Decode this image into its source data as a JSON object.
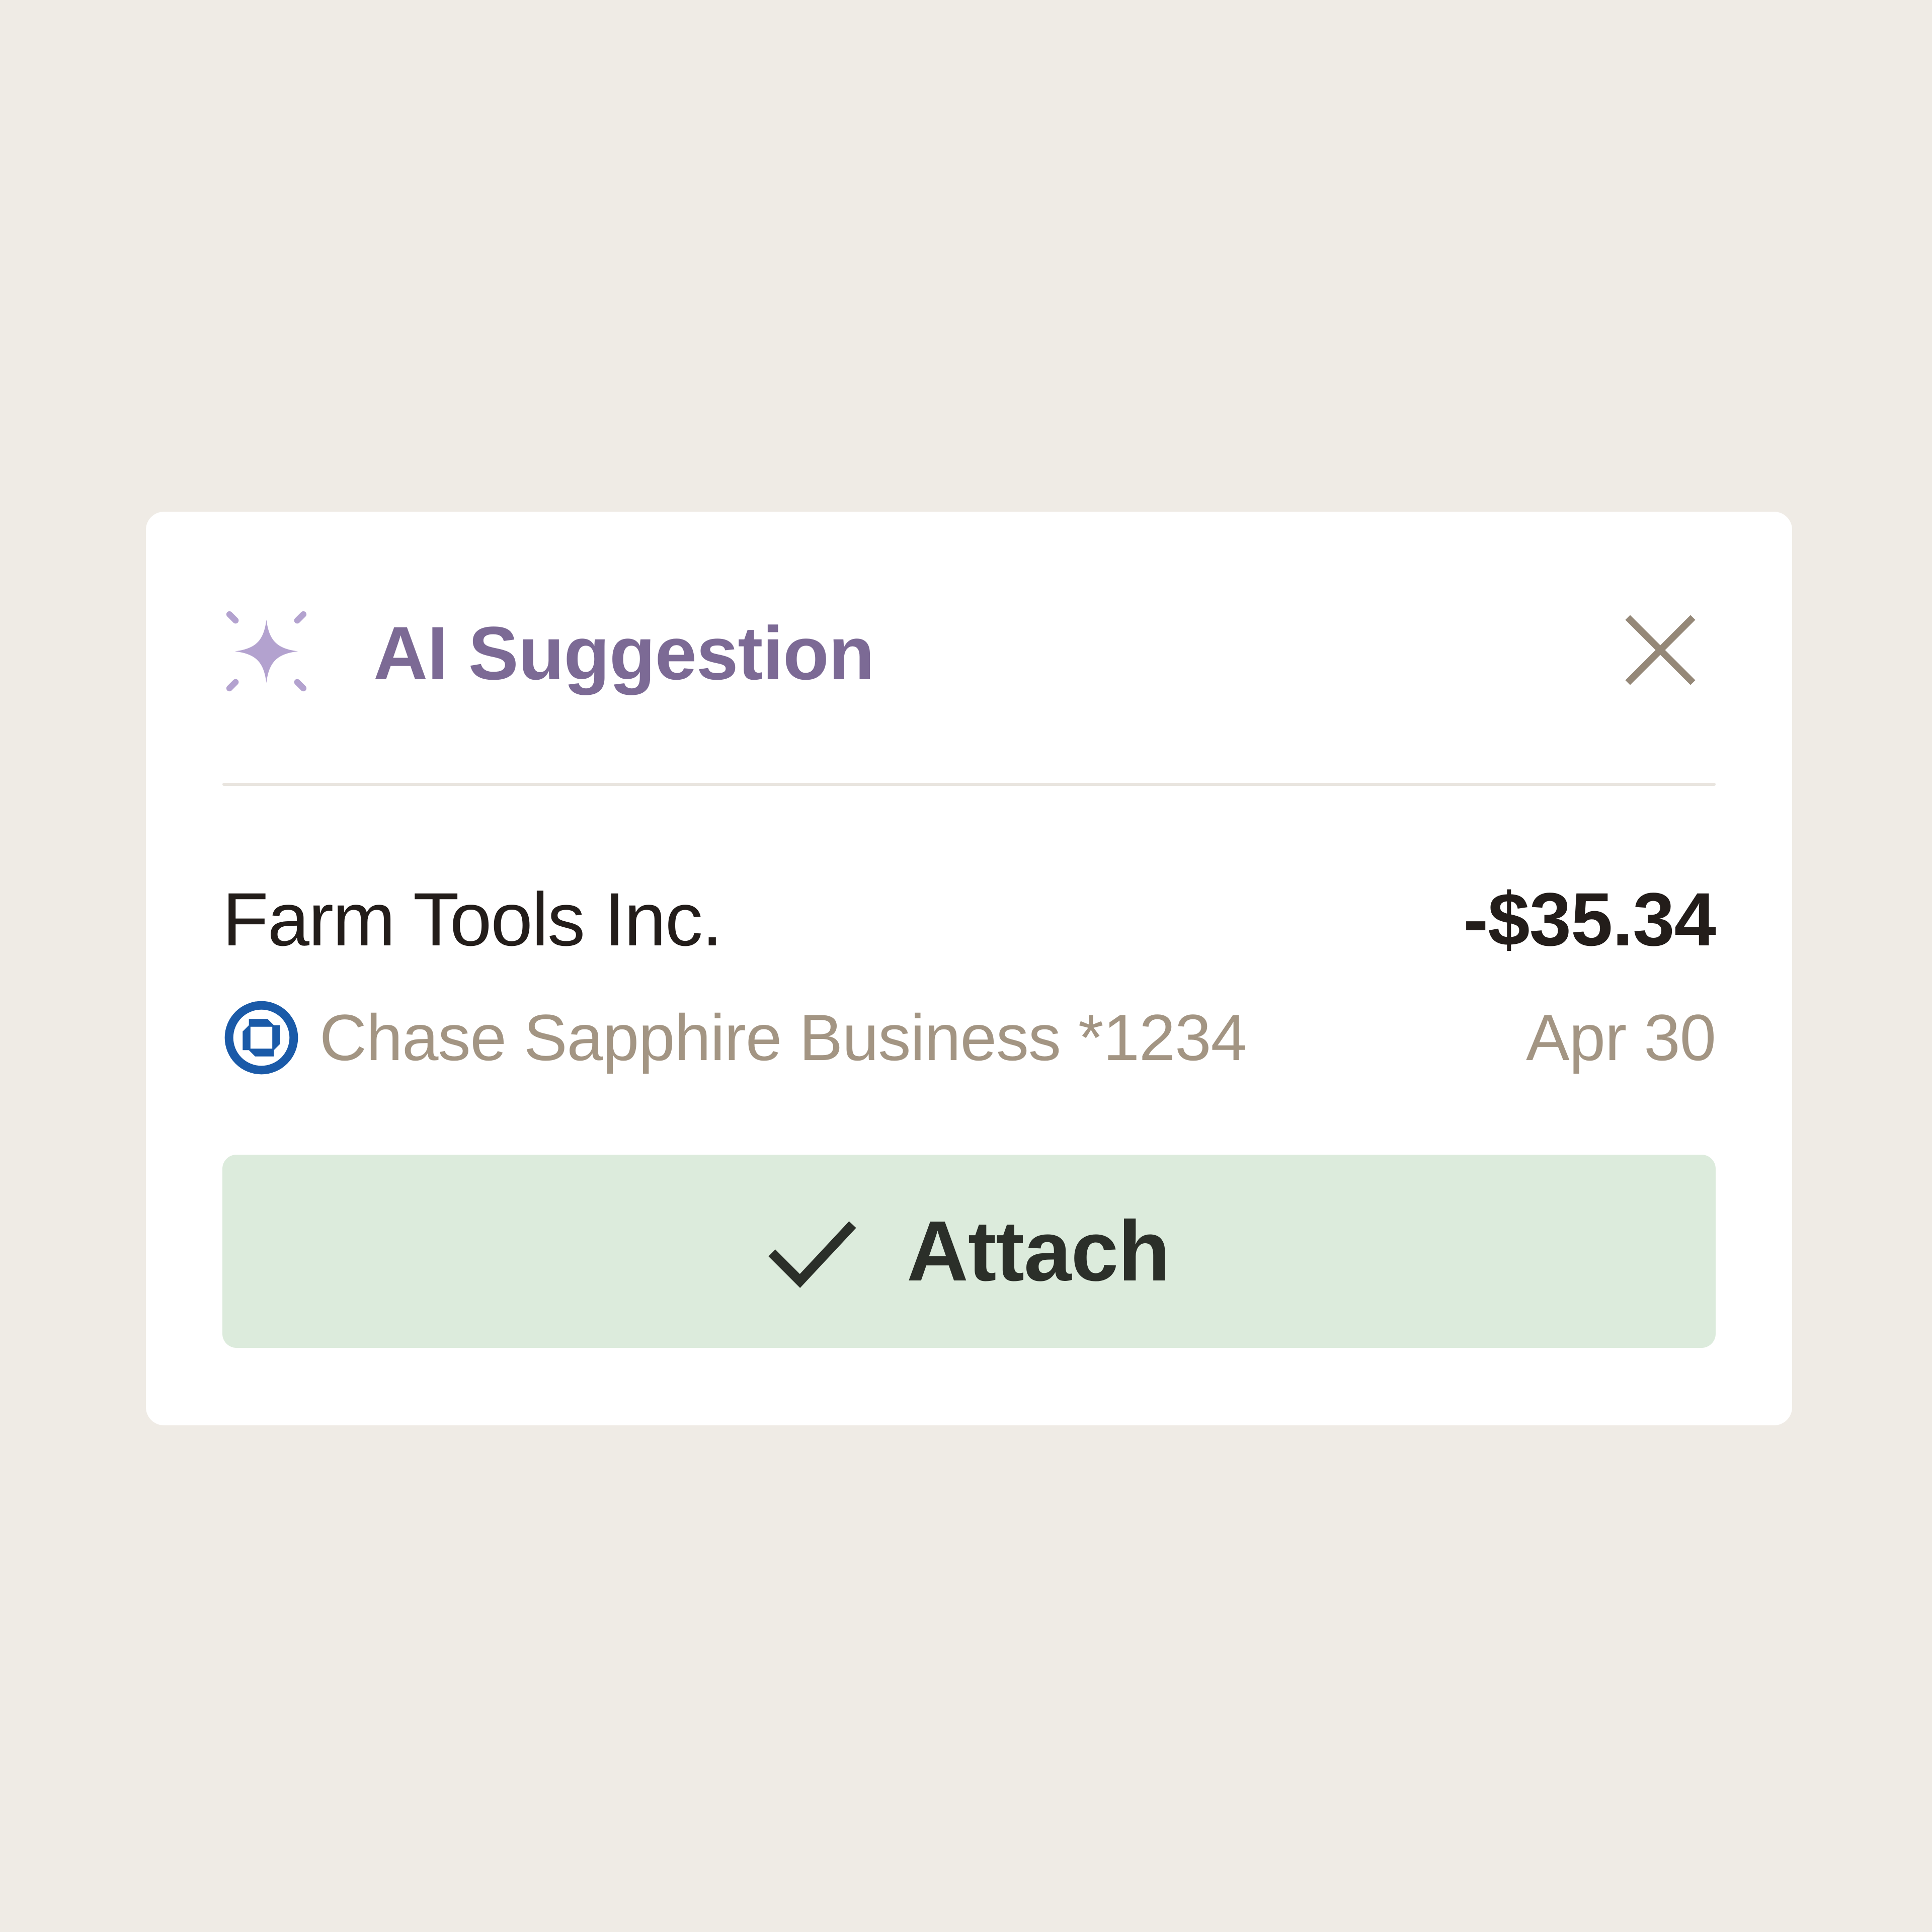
{
  "card": {
    "title": "AI Suggestion",
    "close_label": "Close",
    "transaction": {
      "merchant": "Farm Tools Inc.",
      "amount": "-$35.34",
      "account": "Chase Sapphire Business *1234",
      "date": "Apr 30"
    },
    "attach_label": "Attach"
  },
  "icons": {
    "sparkle": "sparkle-icon",
    "close": "close-icon",
    "bank": "chase-bank-logo-icon",
    "check": "check-icon"
  },
  "colors": {
    "background": "#efebe5",
    "card": "#ffffff",
    "title": "#7c6a95",
    "sparkle": "#b3a2cf",
    "close": "#958878",
    "muted_text": "#a39583",
    "primary_text": "#231d1a",
    "attach_bg": "#dcebdc",
    "attach_text": "#2b2f29",
    "bank_blue": "#1a5aa8"
  }
}
